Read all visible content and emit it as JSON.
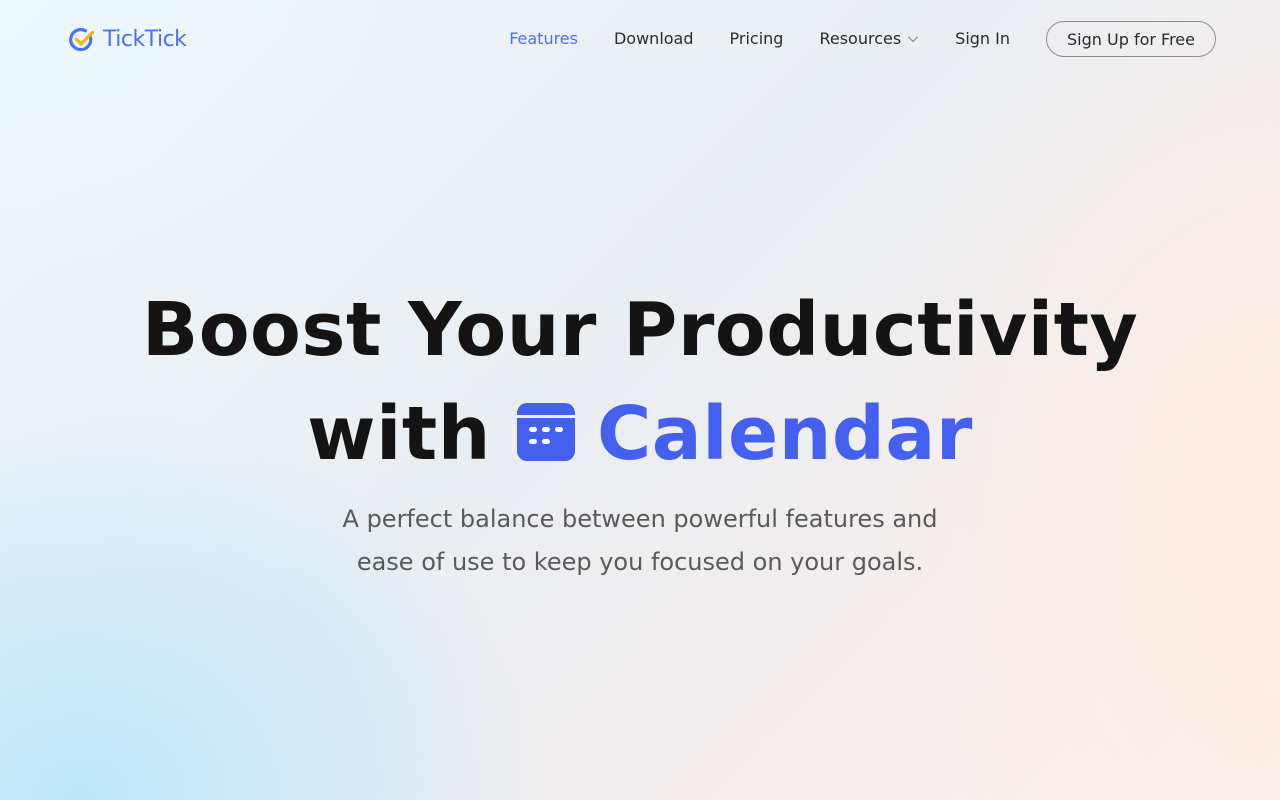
{
  "brand": {
    "name": "TickTick",
    "logo_icon": "ticktick-check-icon",
    "accent_color": "#4772fa"
  },
  "nav": {
    "features": "Features",
    "download": "Download",
    "pricing": "Pricing",
    "resources": "Resources",
    "resources_icon": "chevron-down-icon",
    "sign_in": "Sign In",
    "sign_up": "Sign Up for Free",
    "active_item": "Features"
  },
  "hero": {
    "headline_line1": "Boost Your Productivity",
    "headline_with": "with",
    "feature_icon": "calendar-icon",
    "feature_word": "Calendar",
    "feature_color": "#4361ee",
    "subtitle_line1": "A perfect balance between powerful features and",
    "subtitle_line2": "ease of use to keep you focused on your goals."
  }
}
